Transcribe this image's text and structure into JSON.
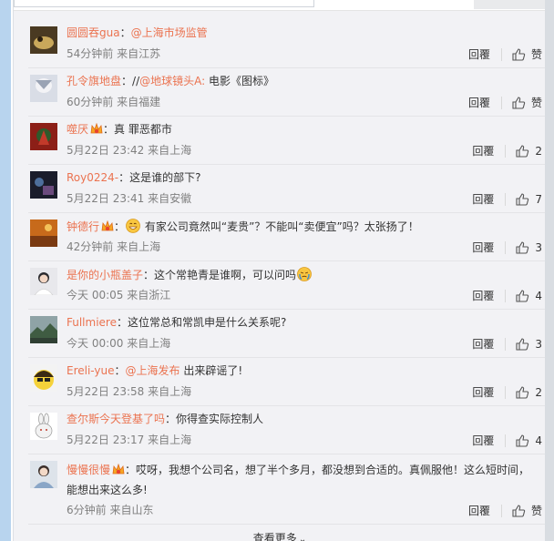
{
  "comments": [
    {
      "user": "圆圆吞gua",
      "vip": false,
      "prefix": "",
      "mention": "@上海市场监管",
      "body": "",
      "time": "54分钟前",
      "source": "来自江苏",
      "reply": "回覆",
      "likes": "赞"
    },
    {
      "user": "孔令旗地盘",
      "vip": false,
      "prefix": "//",
      "mention": "@地球镜头A:",
      "body": " 电影《图标》",
      "time": "60分钟前",
      "source": "来自福建",
      "reply": "回覆",
      "likes": "赞"
    },
    {
      "user": "噬厌",
      "vip": true,
      "prefix": "",
      "mention": "",
      "body": "真 罪恶都市",
      "time": "5月22日 23:42",
      "source": "来自上海",
      "reply": "回覆",
      "likes": "2"
    },
    {
      "user": "Roy0224-",
      "vip": false,
      "prefix": "",
      "mention": "",
      "body": "这是谁的部下?",
      "time": "5月22日 23:41",
      "source": "来自安徽",
      "reply": "回覆",
      "likes": "7"
    },
    {
      "user": "钟德行",
      "vip": true,
      "prefix": "",
      "mention": "",
      "body": "有家公司竟然叫“麦贵”？不能叫“卖便宜”吗？太张扬了！",
      "time": "42分钟前",
      "source": "来自上海",
      "reply": "回覆",
      "likes": "3"
    },
    {
      "user": "是你的小瓶盖子",
      "vip": false,
      "prefix": "",
      "mention": "",
      "body": "这个常艳青是谁啊，可以问吗",
      "time": "今天 00:05",
      "source": "来自浙江",
      "reply": "回覆",
      "likes": "4"
    },
    {
      "user": "Fullmiere",
      "vip": false,
      "prefix": "",
      "mention": "",
      "body": "这位常总和常凯申是什么关系呢?",
      "time": "今天 00:00",
      "source": "来自上海",
      "reply": "回覆",
      "likes": "3"
    },
    {
      "user": "Ereli-yue",
      "vip": false,
      "prefix": "",
      "mention": "@上海发布",
      "body": " 出来辟谣了!",
      "time": "5月22日 23:58",
      "source": "来自上海",
      "reply": "回覆",
      "likes": "2"
    },
    {
      "user": "查尔斯今天登基了吗",
      "vip": false,
      "prefix": "",
      "mention": "",
      "body": "你得查实际控制人",
      "time": "5月22日 23:17",
      "source": "来自上海",
      "reply": "回覆",
      "likes": "4"
    },
    {
      "user": "慢慢很慢",
      "vip": true,
      "prefix": "",
      "mention": "",
      "body": "哎呀，我想个公司名，想了半个多月，都没想到合适的。真佩服他！这么短时间，能想出来这么多!",
      "time": "6分钟前",
      "source": "来自山东",
      "reply": "回覆",
      "likes": "赞"
    }
  ],
  "more": {
    "label": "查看更多"
  }
}
